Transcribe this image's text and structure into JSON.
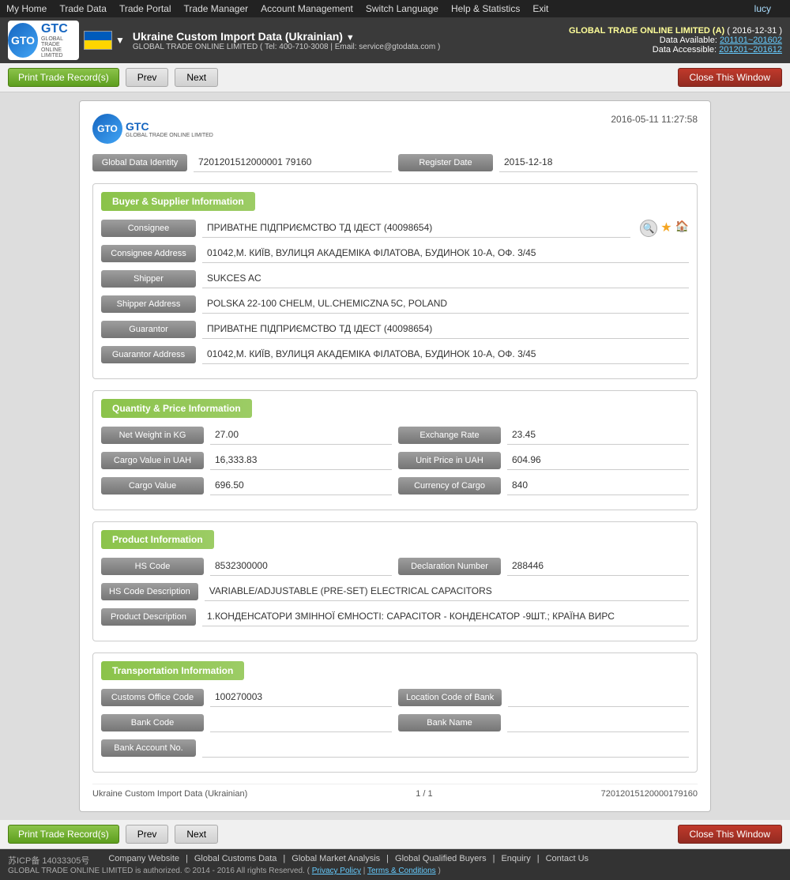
{
  "topnav": {
    "items": [
      "My Home",
      "Trade Data",
      "Trade Portal",
      "Trade Manager",
      "Account Management",
      "Switch Language",
      "Help & Statistics",
      "Exit"
    ],
    "user": "lucy"
  },
  "header": {
    "company_name": "GLOBAL TRADE ONLINE LIMITED (A)",
    "period": "( 2016-12-31 )",
    "data_available_label": "Data Available:",
    "data_available_value": "201101~201602",
    "data_accessible_label": "Data Accessible:",
    "data_accessible_value": "201201~201612",
    "title": "Ukraine Custom Import Data (Ukrainian)",
    "subtitle": "GLOBAL TRADE ONLINE LIMITED ( Tel: 400-710-3008 | Email: service@gtodata.com )"
  },
  "toolbar": {
    "print_label": "Print Trade Record(s)",
    "prev_label": "Prev",
    "next_label": "Next",
    "close_label": "Close This Window"
  },
  "card": {
    "timestamp": "2016-05-11 11:27:58",
    "global_data_identity_label": "Global Data Identity",
    "global_data_identity_value": "7201201512000001 79160",
    "register_date_label": "Register Date",
    "register_date_value": "2015-12-18"
  },
  "buyer_supplier": {
    "section_title": "Buyer & Supplier Information",
    "consignee_label": "Consignee",
    "consignee_value": "ПРИВАТНЕ ПІДПРИЄМСТВО ТД ІДЕСТ (40098654)",
    "consignee_address_label": "Consignee Address",
    "consignee_address_value": "01042,М. КИЇВ, ВУЛИЦЯ АКАДЕМІКА ФІЛАТОВА, БУДИНОК 10-А, ОФ. 3/45",
    "shipper_label": "Shipper",
    "shipper_value": "SUKCES AC",
    "shipper_address_label": "Shipper Address",
    "shipper_address_value": "POLSKA 22-100 CHELM, UL.CHEMICZNA 5C, POLAND",
    "guarantor_label": "Guarantor",
    "guarantor_value": "ПРИВАТНЕ ПІДПРИЄМСТВО ТД ІДЕСТ  (40098654)",
    "guarantor_address_label": "Guarantor Address",
    "guarantor_address_value": "01042,М. КИЇВ, ВУЛИЦЯ АКАДЕМІКА ФІЛАТОВА, БУДИНОК 10-А, ОФ. 3/45"
  },
  "quantity_price": {
    "section_title": "Quantity & Price Information",
    "net_weight_label": "Net Weight in KG",
    "net_weight_value": "27.00",
    "exchange_rate_label": "Exchange Rate",
    "exchange_rate_value": "23.45",
    "cargo_value_uah_label": "Cargo Value in UAH",
    "cargo_value_uah_value": "16,333.83",
    "unit_price_uah_label": "Unit Price in UAH",
    "unit_price_uah_value": "604.96",
    "cargo_value_label": "Cargo Value",
    "cargo_value_value": "696.50",
    "currency_cargo_label": "Currency of Cargo",
    "currency_cargo_value": "840"
  },
  "product": {
    "section_title": "Product Information",
    "hs_code_label": "HS Code",
    "hs_code_value": "8532300000",
    "declaration_number_label": "Declaration Number",
    "declaration_number_value": "288446",
    "hs_code_desc_label": "HS Code Description",
    "hs_code_desc_value": "VARIABLE/ADJUSTABLE (PRE-SET) ELECTRICAL CAPACITORS",
    "product_desc_label": "Product Description",
    "product_desc_value": "1.КОНДЕНСАТОРИ ЗМІННОЇ ЄМНОСТІ: CAPACITOR - КОНДЕНСАТОР -9ШТ.; КРАЇНА ВИРС"
  },
  "transportation": {
    "section_title": "Transportation Information",
    "customs_office_label": "Customs Office Code",
    "customs_office_value": "100270003",
    "location_bank_label": "Location Code of Bank",
    "location_bank_value": "",
    "bank_code_label": "Bank Code",
    "bank_code_value": "",
    "bank_name_label": "Bank Name",
    "bank_name_value": "",
    "bank_account_label": "Bank Account No.",
    "bank_account_value": ""
  },
  "card_footer": {
    "record_type": "Ukraine Custom Import Data (Ukrainian)",
    "page_info": "1 / 1",
    "record_id": "72012015120000179160"
  },
  "site_footer": {
    "icp": "苏ICP备 14033305号",
    "links": [
      "Company Website",
      "Global Customs Data",
      "Global Market Analysis",
      "Global Qualified Buyers",
      "Enquiry",
      "Contact Us"
    ],
    "separators": [
      "|",
      "|",
      "|",
      "|",
      "|"
    ],
    "copyright": "GLOBAL TRADE ONLINE LIMITED is authorized. © 2014 - 2016 All rights Reserved.",
    "privacy": "Privacy Policy",
    "terms": "Terms & Conditions"
  }
}
